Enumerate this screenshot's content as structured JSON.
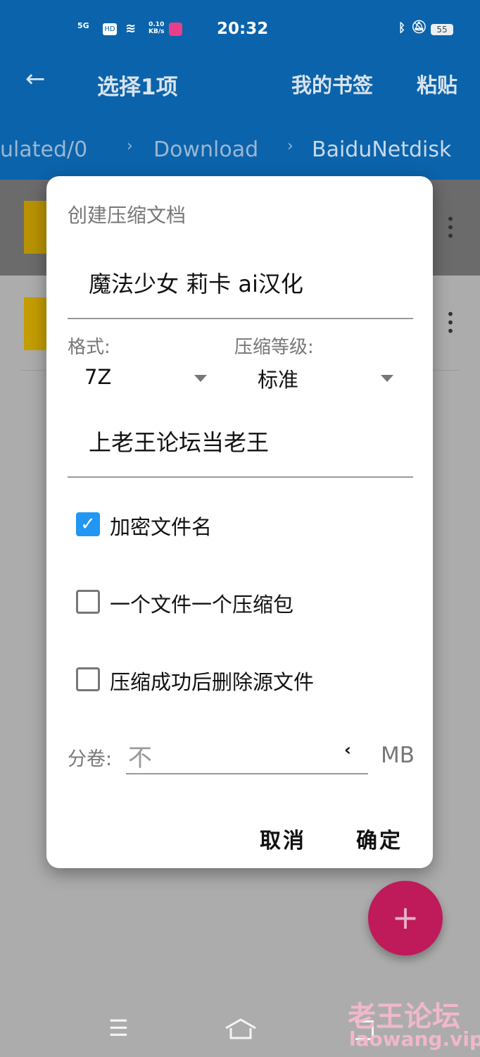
{
  "status_bar": {
    "network": "5G",
    "hd": "HD",
    "speed": "0.10",
    "speed_unit": "KB/s",
    "time": "20:32",
    "battery": "55"
  },
  "app_bar": {
    "title": "选择1项",
    "bookmarks": "我的书签",
    "paste": "粘贴"
  },
  "breadcrumb": [
    "ulated/0",
    "Download",
    "BaiduNetdisk"
  ],
  "dialog": {
    "title": "创建压缩文档",
    "filename": "魔法少女 莉卡 ai汉化",
    "format_label": "格式:",
    "format_value": "7Z",
    "level_label": "压缩等级:",
    "level_value": "标准",
    "password": "上老王论坛当老王",
    "options": [
      {
        "label": "加密文件名",
        "checked": true
      },
      {
        "label": "一个文件一个压缩包",
        "checked": false
      },
      {
        "label": "压缩成功后删除源文件",
        "checked": false
      }
    ],
    "split_label": "分卷:",
    "split_placeholder": "不",
    "split_unit": "MB",
    "cancel": "取消",
    "ok": "确定"
  },
  "fab": "+",
  "watermark": {
    "text": "老王论坛",
    "url": "laowang.vip"
  },
  "colors": {
    "app_bar": "#0b63ab",
    "checkbox": "#2196f3",
    "fab": "#bf1a5a"
  }
}
